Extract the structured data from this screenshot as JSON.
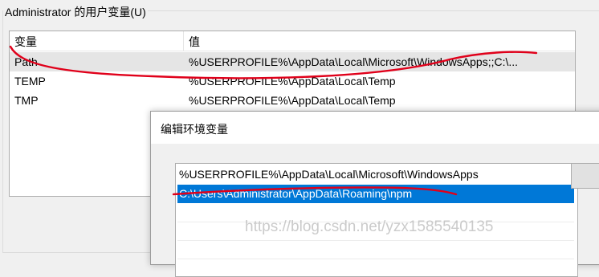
{
  "user_vars": {
    "title": "Administrator 的用户变量(U)",
    "columns": {
      "name": "变量",
      "value": "值"
    },
    "rows": [
      {
        "name": "Path",
        "value": "%USERPROFILE%\\AppData\\Local\\Microsoft\\WindowsApps;;C:\\..."
      },
      {
        "name": "TEMP",
        "value": "%USERPROFILE%\\AppData\\Local\\Temp"
      },
      {
        "name": "TMP",
        "value": "%USERPROFILE%\\AppData\\Local\\Temp"
      }
    ]
  },
  "edit_dialog": {
    "title": "编辑环境变量",
    "items": [
      "%USERPROFILE%\\AppData\\Local\\Microsoft\\WindowsApps",
      "C:\\Users\\Administrator\\AppData\\Roaming\\npm"
    ]
  },
  "watermark": "https://blog.csdn.net/yzx1585540135",
  "colors": {
    "selection": "#0078d7",
    "annotation": "#e0001a"
  }
}
